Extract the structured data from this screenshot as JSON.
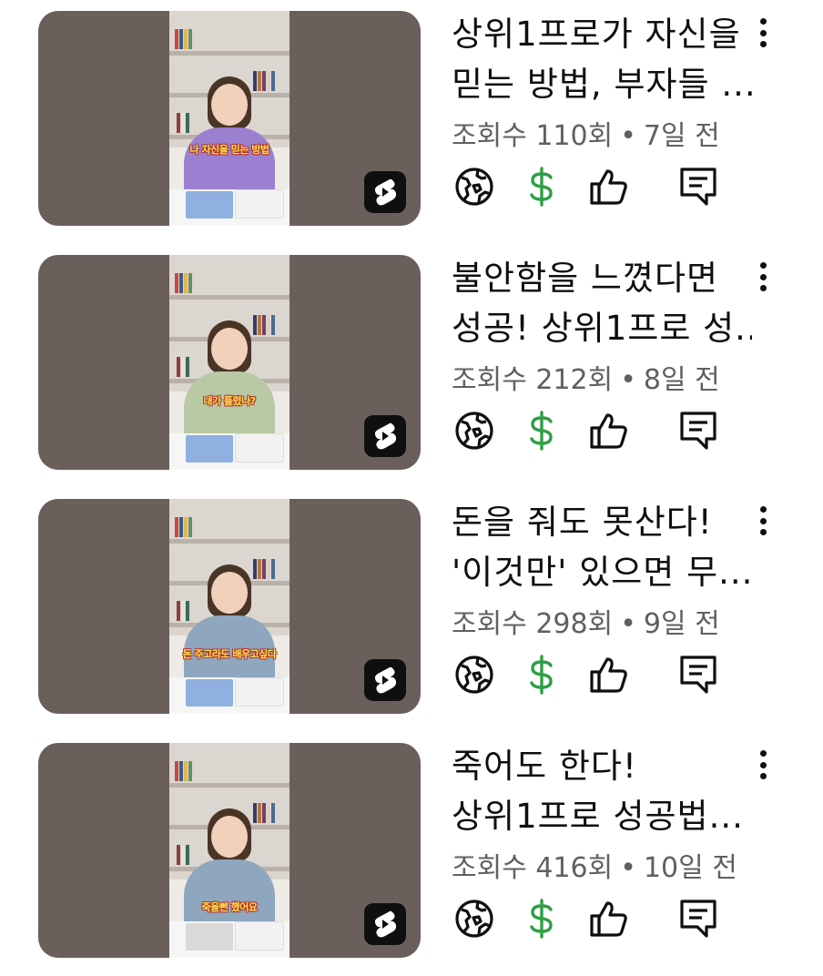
{
  "colors": {
    "thumbnail_bg": "#6b5f5c",
    "monetization_green": "#2f9e44",
    "text_primary": "#0f0f0f",
    "text_secondary": "#606060"
  },
  "videos": [
    {
      "title_line1": "상위1프로가 자신을",
      "title_line2": "믿는 방법, 부자들 ...",
      "views": "조회수 110회",
      "separator": "•",
      "age": "7일 전",
      "caption": "나 자신을 믿는 방법",
      "shirt": "#9b7fd1",
      "desk_book": "#8fb0e0"
    },
    {
      "title_line1": "불안함을 느꼈다면",
      "title_line2": "성공! 상위1프로 성...",
      "views": "조회수 212회",
      "separator": "•",
      "age": "8일 전",
      "caption": "내가 틀렸나?",
      "shirt": "#b9c9a6",
      "desk_book": "#8fb0e0"
    },
    {
      "title_line1": "돈을 줘도 못산다!",
      "title_line2": "'이것만' 있으면 무...",
      "views": "조회수 298회",
      "separator": "•",
      "age": "9일 전",
      "caption": "돈 주고라도 배우고싶다",
      "shirt": "#8fa6bf",
      "desk_book": "#8fb0e0"
    },
    {
      "title_line1": "죽어도 한다!",
      "title_line2": "상위1프로 성공법...",
      "views": "조회수 416회",
      "separator": "•",
      "age": "10일 전",
      "caption": "죽을뻔 했어요",
      "shirt": "#8fa6bf",
      "desk_book": "#d9d9d9"
    }
  ],
  "icons": {
    "visibility": "globe-icon",
    "monetization": "dollar-icon",
    "likes": "thumbs-up-icon",
    "comments": "comment-icon",
    "menu": "kebab-menu-icon",
    "shorts": "shorts-icon"
  }
}
